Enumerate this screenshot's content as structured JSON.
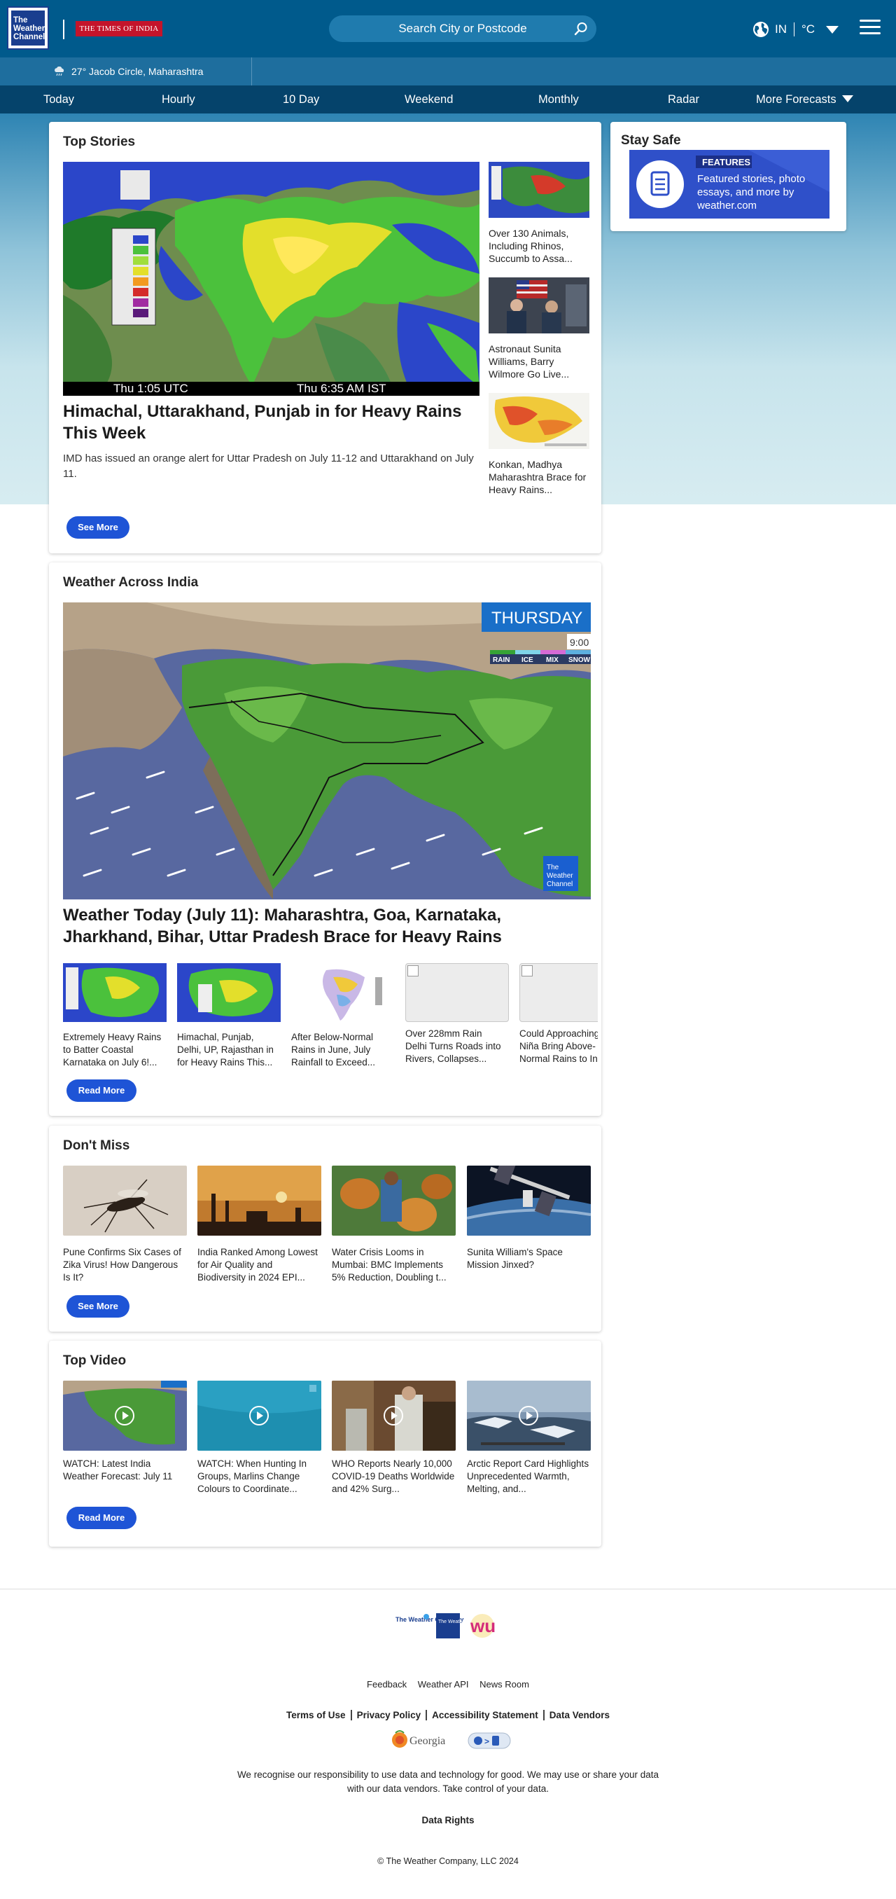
{
  "header": {
    "logo_text": "The Weather Channel",
    "partner_logo": "THE TIMES OF INDIA",
    "search_placeholder": "Search City or Postcode",
    "region": "IN",
    "unit": "°C"
  },
  "location_bar": {
    "temp_location": "27° Jacob Circle, Maharashtra"
  },
  "nav": {
    "items": [
      "Today",
      "Hourly",
      "10 Day",
      "Weekend",
      "Monthly",
      "Radar",
      "More Forecasts"
    ]
  },
  "top_stories": {
    "heading": "Top Stories",
    "map_caption_left": "Thu   1:05 UTC",
    "map_caption_right": "Thu      6:35 AM IST",
    "main_title": "Himachal, Uttarakhand, Punjab in for Heavy Rains This Week",
    "main_desc": "IMD has issued an orange alert for Uttar Pradesh on July 11-12 and Uttarakhand on July 11.",
    "side": [
      "Over 130 Animals, Including Rhinos, Succumb to Assa...",
      "Astronaut Sunita Williams, Barry Wilmore Go Live...",
      "Konkan, Madhya Maharashtra Brace for Heavy Rains..."
    ],
    "button": "See More"
  },
  "stay_safe": {
    "heading": "Stay Safe",
    "badge": "FEATURES",
    "promo_line1": "Featured stories, photo",
    "promo_line2": "essays, and more by",
    "promo_line3": "weather.com"
  },
  "weather_across_india": {
    "heading": "Weather Across India",
    "map_day": "THURSDAY",
    "map_time": "9:00",
    "map_legend": [
      "RAIN",
      "ICE",
      "MIX",
      "SNOW"
    ],
    "map_logo": "The Weather Channel",
    "main_title": "Weather Today (July 11): Maharashtra, Goa, Karnataka, Jharkhand, Bihar, Uttar Pradesh Brace for Heavy Rains",
    "strip": [
      [
        "Extremely Heavy Rains",
        "to Batter Coastal",
        "Karnataka on July 6!..."
      ],
      [
        "Himachal, Punjab,",
        "Delhi, UP, Rajasthan in",
        "for Heavy Rains This..."
      ],
      [
        "After Below-Normal",
        "Rains in June, July",
        "Rainfall to Exceed..."
      ],
      [
        "Over 228mm Rain",
        "Delhi Turns Roads into",
        "Rivers, Collapses..."
      ],
      [
        "Could Approaching",
        "Niña Bring Above-",
        "Normal Rains to In"
      ]
    ],
    "button": "Read More"
  },
  "dont_miss": {
    "heading": "Don't Miss",
    "items": [
      "Pune Confirms Six Cases of Zika Virus! How Dangerous Is It?",
      "India Ranked Among Lowest for Air Quality and Biodiversity in 2024 EPI...",
      "Water Crisis Looms in Mumbai: BMC Implements 5% Reduction, Doubling t...",
      "Sunita William's Space Mission Jinxed?"
    ],
    "button": "See More"
  },
  "top_video": {
    "heading": "Top Video",
    "items": [
      "WATCH: Latest India Weather Forecast: July 11",
      "WATCH: When Hunting In Groups, Marlins Change Colours to Coordinate...",
      "WHO Reports Nearly 10,000 COVID-19 Deaths Worldwide and 42% Surg...",
      "Arctic Report Card Highlights Unprecedented Warmth, Melting, and..."
    ],
    "button": "Read More"
  },
  "footer": {
    "logo_twc": "The Weather Company",
    "logo_channel": "The Weather Channel",
    "logo_wu": "wu",
    "links": [
      "Feedback",
      "Weather API",
      "News Room"
    ],
    "legal": [
      "Terms of Use",
      "Privacy Policy",
      "Accessibility Statement",
      "Data Vendors"
    ],
    "georgia": "Georgia",
    "recognise": "We recognise our responsibility to use data and technology for good. We may use or share your data with our data vendors. Take control of your data.",
    "data_rights": "Data Rights",
    "copyright": "© The Weather Company, LLC 2024"
  },
  "colors": {
    "header_bg": "#005a8c",
    "location_bar_bg": "#1e6e9e",
    "nav_bg": "#05436b",
    "button_blue": "#1e54d6",
    "toi_red": "#c4142b"
  }
}
